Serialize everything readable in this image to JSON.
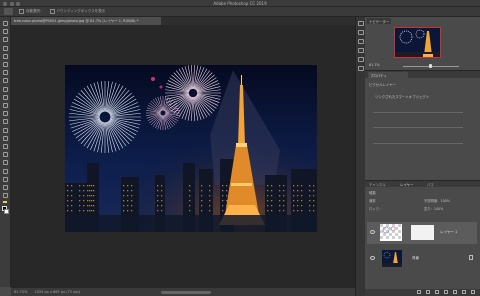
{
  "app": {
    "window_title": "Adobe Photoshop CC 2019"
  },
  "options_bar": {
    "auto_select_label": "自動選択：",
    "transform_label": "バウンディングボックスを表示"
  },
  "document_tab": {
    "label": "tree-color-photo@P0001-gimp/photo.jpg @ 61.7% (レイヤー 1, RGB/8) *"
  },
  "status_bar": {
    "zoom": "61.73%",
    "doc_info": "1024 px x 667 px (72 ppi)"
  },
  "navigator": {
    "tab_label": "ナビゲーター",
    "zoom_value": "61.7%"
  },
  "adjustments": {
    "tab_label": "プロパティ",
    "section_label": "ピクセルレイヤー",
    "linked_label": "リンクされたスマートオブジェクト"
  },
  "layers_panel": {
    "tabs": [
      "チャンネル",
      "レイヤー",
      "パス"
    ],
    "kind_label": "種類",
    "blend_mode": "通常",
    "opacity_label": "不透明度：100%",
    "lock_label": "ロック：",
    "fill_label": "塗り：100%",
    "layers": [
      {
        "name": "レイヤー 1",
        "selected": true
      },
      {
        "name": "背景",
        "selected": false
      }
    ]
  },
  "icons": {
    "tools": [
      "move-icon",
      "marquee-icon",
      "lasso-icon",
      "quick-select-icon",
      "crop-icon",
      "frame-icon",
      "eyedropper-icon",
      "healing-icon",
      "brush-icon",
      "stamp-icon",
      "history-brush-icon",
      "eraser-icon",
      "gradient-icon",
      "blur-icon",
      "dodge-icon",
      "pen-icon",
      "type-icon",
      "path-select-icon",
      "rectangle-icon",
      "hand-icon",
      "zoom-icon",
      "more-tools-icon"
    ]
  },
  "colors": {
    "selection_accent": "#d0302c",
    "foreground": "#0b0b0b",
    "background": "#ffffff"
  }
}
